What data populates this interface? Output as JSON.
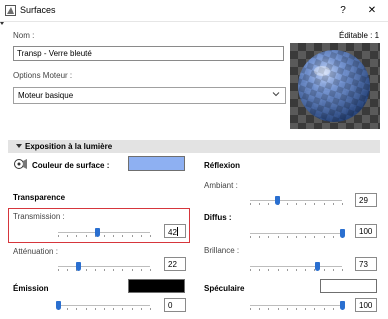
{
  "window": {
    "title": "Surfaces",
    "help_label": "?",
    "close_label": "✕"
  },
  "general": {
    "name_label": "Nom :",
    "editable_label": "Éditable : 1",
    "name_value": "Transp - Verre bleuté",
    "engine_label": "Options Moteur :",
    "engine_value": "Moteur basique"
  },
  "section": {
    "title": "Exposition à la lumière"
  },
  "surface_color": {
    "label": "Couleur de surface :",
    "color": "#8eb0f2"
  },
  "transparency": {
    "heading": "Transparence",
    "transmission_label": "Transmission :",
    "transmission_value": "42",
    "transmission_level": 0.42,
    "attenuation_label": "Atténuation :",
    "attenuation_value": "22",
    "attenuation_level": 0.22
  },
  "emission": {
    "label": "Émission",
    "color": "#000000",
    "value": "0",
    "level": 0.0
  },
  "reflection": {
    "heading": "Réflexion",
    "ambient_label": "Ambiant :",
    "ambient_value": "29",
    "ambient_level": 0.29,
    "diffuse_label": "Diffus :",
    "diffuse_value": "100",
    "diffuse_level": 1.0,
    "shininess_label": "Brillance :",
    "shininess_value": "73",
    "shininess_level": 0.73,
    "specular_label": "Spéculaire",
    "specular_color": "#ffffff",
    "specular_value": "100",
    "specular_level": 1.0
  },
  "colors": {
    "accent": "#2a6fd0",
    "highlight": "#d6363c"
  }
}
